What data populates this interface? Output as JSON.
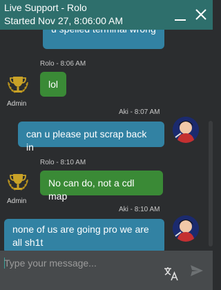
{
  "header": {
    "title": "Live Support - Rolo",
    "started": "Started  Nov 27, 8:06:00 AM"
  },
  "messages": [
    {
      "text": "u spelled terminal wrong"
    },
    {
      "meta": "Rolo - 8:06 AM",
      "text": "lol",
      "role": "Admin"
    },
    {
      "meta": "Aki - 8:07 AM",
      "text": "can u please put scrap back in"
    },
    {
      "meta": "Rolo - 8:10 AM",
      "text": "No can do, not a cdl map",
      "role": "Admin"
    },
    {
      "meta": "Aki - 8:10 AM",
      "text_line1": "none of us are going pro we are",
      "text_line2": "all sh1t"
    }
  ],
  "composer": {
    "placeholder": "Type your message..."
  },
  "icons": {
    "minimize": "minimize-icon",
    "close": "close-icon",
    "translate": "translate-icon",
    "send": "send-icon",
    "admin_avatar": "trophy-laurel-icon"
  },
  "colors": {
    "header": "#2e6f6c",
    "user_bubble": "#3282a3",
    "agent_bubble": "#3a8a36",
    "background": "#2b2d2f",
    "composer": "#474a4c"
  }
}
